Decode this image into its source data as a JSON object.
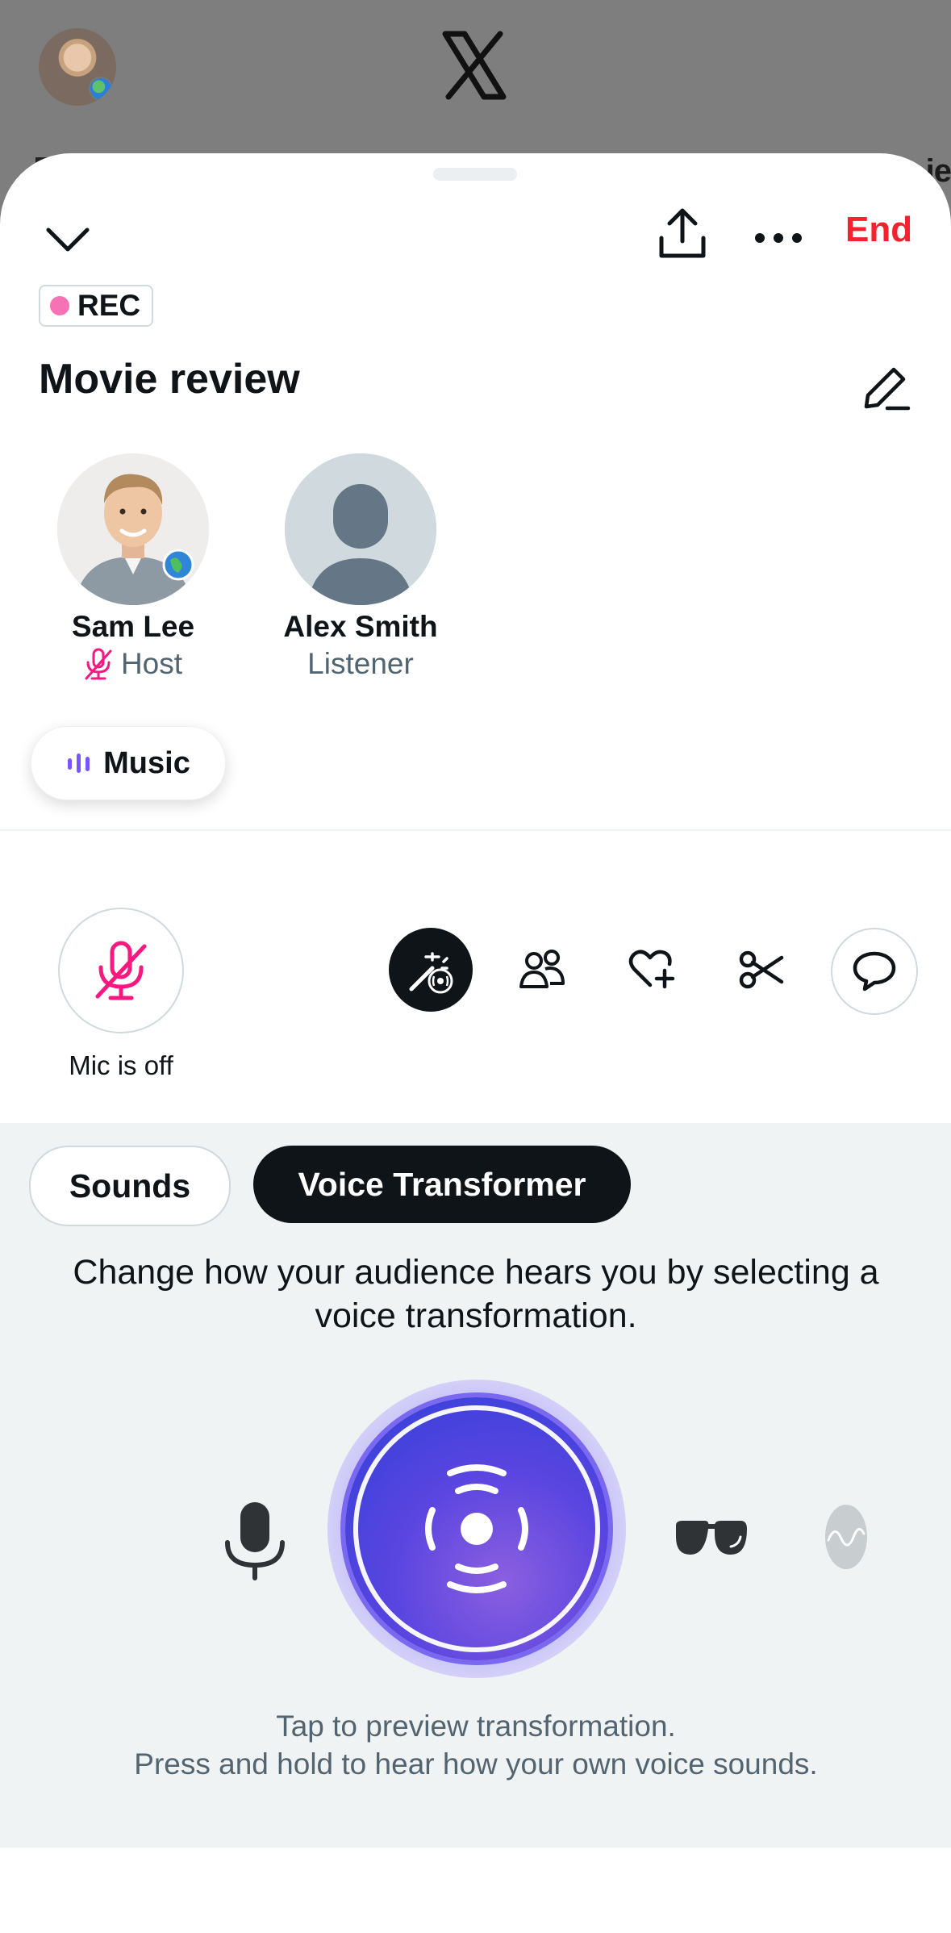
{
  "background": {
    "peek_text": "ie"
  },
  "header": {
    "end_label": "End"
  },
  "badge": {
    "rec_label": "REC"
  },
  "space": {
    "title": "Movie review"
  },
  "participants": [
    {
      "name": "Sam Lee",
      "role": "Host"
    },
    {
      "name": "Alex Smith",
      "role": "Listener"
    }
  ],
  "music_chip": {
    "label": "Music"
  },
  "controls": {
    "mic_label": "Mic is off",
    "toolbar_icons": [
      "voice-effects-icon",
      "people-icon",
      "heart-plus-icon",
      "scissors-icon",
      "chat-bubble-icon"
    ]
  },
  "panel": {
    "tabs": [
      {
        "label": "Sounds",
        "selected": false
      },
      {
        "label": "Voice Transformer",
        "selected": true
      }
    ],
    "description": "Change how your audience hears you by selecting a voice transformation.",
    "hint_line1": "Tap to preview transformation.",
    "hint_line2": "Press and hold to hear how your own voice sounds."
  },
  "colors": {
    "end": "#f4212e",
    "rec_dot": "#f772b5",
    "accent_purple": "#5a45e0",
    "muted_mic": "#f91880"
  }
}
